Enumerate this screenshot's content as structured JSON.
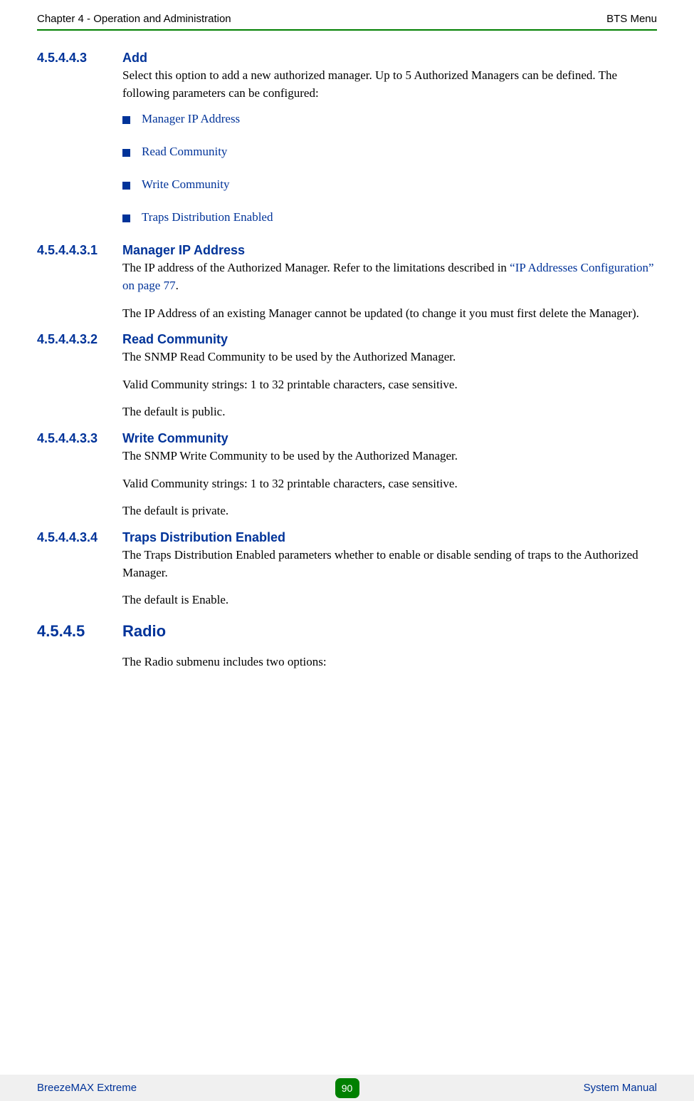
{
  "header": {
    "left": "Chapter 4 - Operation and Administration",
    "right": "BTS Menu"
  },
  "sections": {
    "s1": {
      "num": "4.5.4.4.3",
      "title": "Add",
      "body": "Select this option to add a new authorized manager. Up to 5 Authorized Managers can be defined. The following parameters can be configured:"
    },
    "bullets": {
      "b1": "Manager IP Address",
      "b2": "Read Community",
      "b3": "Write Community",
      "b4": "Traps Distribution Enabled"
    },
    "s2": {
      "num": "4.5.4.4.3.1",
      "title": "Manager IP Address",
      "p1a": "The IP address of the Authorized Manager. Refer to the limitations described in ",
      "p1b": "“IP Addresses Configuration” on page 77",
      "p1c": ".",
      "p2": "The IP Address of an existing Manager cannot be updated (to change it you must first delete the Manager)."
    },
    "s3": {
      "num": "4.5.4.4.3.2",
      "title": "Read Community",
      "p1": "The SNMP Read Community to be used by the Authorized Manager.",
      "p2": "Valid Community strings: 1 to 32 printable characters, case sensitive.",
      "p3": "The default is public."
    },
    "s4": {
      "num": "4.5.4.4.3.3",
      "title": "Write Community",
      "p1": "The SNMP Write Community to be used by the Authorized Manager.",
      "p2": "Valid Community strings: 1 to 32 printable characters, case sensitive.",
      "p3": "The default is private."
    },
    "s5": {
      "num": "4.5.4.4.3.4",
      "title": "Traps Distribution Enabled",
      "p1": "The Traps Distribution Enabled parameters whether to enable or disable sending of traps to the Authorized Manager.",
      "p2": "The default is Enable."
    },
    "s6": {
      "num": "4.5.4.5",
      "title": "Radio",
      "p1": "The Radio submenu includes two options:"
    }
  },
  "footer": {
    "left": "BreezeMAX Extreme",
    "page": "90",
    "right": "System Manual"
  }
}
